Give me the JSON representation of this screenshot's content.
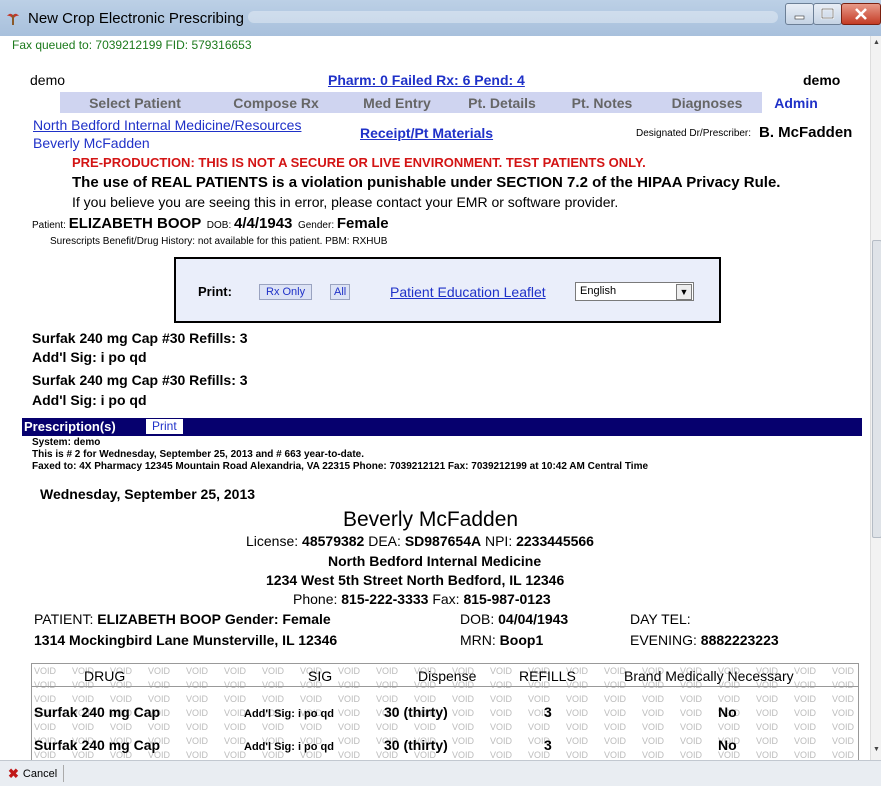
{
  "window": {
    "title": "New Crop Electronic Prescribing",
    "icon": "caduceus-icon",
    "buttons": [
      "minimize-icon",
      "maximize-icon",
      "close-icon"
    ]
  },
  "header": {
    "fax_queued": "Fax queued to: 7039212199 FID: 579316653",
    "user_left": "demo",
    "user_right": "demo",
    "pharm_status": "Pharm: 0  Failed Rx: 6  Pend: 4"
  },
  "tabs": [
    {
      "label": "Select Patient",
      "active": false
    },
    {
      "label": "Compose Rx",
      "active": false
    },
    {
      "label": "Med Entry",
      "active": false
    },
    {
      "label": "Pt. Details",
      "active": false
    },
    {
      "label": "Pt. Notes",
      "active": false
    },
    {
      "label": "Diagnoses",
      "active": false
    },
    {
      "label": "Admin",
      "active": true
    }
  ],
  "practice": {
    "org_link": "North Bedford Internal Medicine/Resources",
    "doctor_link": "Beverly McFadden",
    "receipt_link": "Receipt/Pt Materials",
    "designated_label": "Designated Dr/Prescriber:",
    "designated_value": "B. McFadden"
  },
  "warnings": {
    "preprod": "PRE-PRODUCTION: THIS IS NOT A SECURE OR LIVE ENVIRONMENT. TEST PATIENTS ONLY.",
    "real": "The use of REAL PATIENTS is a violation punishable under SECTION 7.2 of the HIPAA Privacy Rule.",
    "believe": "If you believe you are seeing this in error, please contact your EMR or software provider."
  },
  "patient": {
    "label": "Patient:",
    "name": "ELIZABETH BOOP",
    "dob_label": "DOB:",
    "dob": "4/4/1943",
    "gender_label": "Gender:",
    "gender": "Female",
    "surescripts": "Surescripts Benefit/Drug History: not available for this patient. PBM: RXHUB"
  },
  "print_box": {
    "label": "Print:",
    "rx_only": "Rx Only",
    "all": "All",
    "leaflet": "Patient Education Leaflet",
    "language": "English"
  },
  "drugs": [
    "Surfak 240 mg Cap  #30 Refills: 3",
    "Add'l Sig: i po qd",
    "Surfak 240 mg Cap  #30 Refills: 3",
    "Add'l Sig: i po qd"
  ],
  "prescriptions": {
    "bar_title": "Prescription(s)",
    "print": "Print",
    "system": "System: demo",
    "number": "This is # 2 for Wednesday, September 25, 2013 and # 663 year-to-date.",
    "faxed": "Faxed to: 4X Pharmacy 12345 Mountain Road Alexandria, VA 22315 Phone: 7039212121 Fax: 7039212199 at 10:42 AM Central Time"
  },
  "rx_document": {
    "date": "Wednesday, September 25, 2013",
    "prescriber": "Beverly McFadden",
    "license_label": "License:",
    "license": "48579382",
    "dea_label": "DEA:",
    "dea": "SD987654A",
    "npi_label": "NPI:",
    "npi": "2233445566",
    "practice": "North Bedford Internal Medicine",
    "address": "1234 West 5th Street  North Bedford, IL 12346",
    "phone_label": "Phone:",
    "phone": "815-222-3333",
    "fax_label": "Fax:",
    "fax": "815-987-0123",
    "patient_label": "PATIENT:",
    "patient_name": "ELIZABETH BOOP",
    "gender_label": "Gender:",
    "gender": "Female",
    "dob_label": "DOB:",
    "dob": "04/04/1943",
    "daytel_label": "DAY TEL:",
    "patient_address": "1314 Mockingbird Lane  Munsterville, IL 12346",
    "mrn_label": "MRN:",
    "mrn": "Boop1",
    "evening_label": "EVENING:",
    "evening": "8882223223"
  },
  "rx_table": {
    "watermark": "VOID",
    "headers": [
      "DRUG",
      "SIG",
      "Dispense",
      "REFILLS",
      "Brand Medically Necessary"
    ],
    "rows": [
      [
        "Surfak 240 mg Cap",
        "Add'l Sig: i po qd",
        "30 (thirty)",
        "3",
        "No"
      ],
      [
        "Surfak 240 mg Cap",
        "Add'l Sig: i po qd",
        "30 (thirty)",
        "3",
        "No"
      ]
    ]
  },
  "statusbar": {
    "cancel": "Cancel"
  }
}
